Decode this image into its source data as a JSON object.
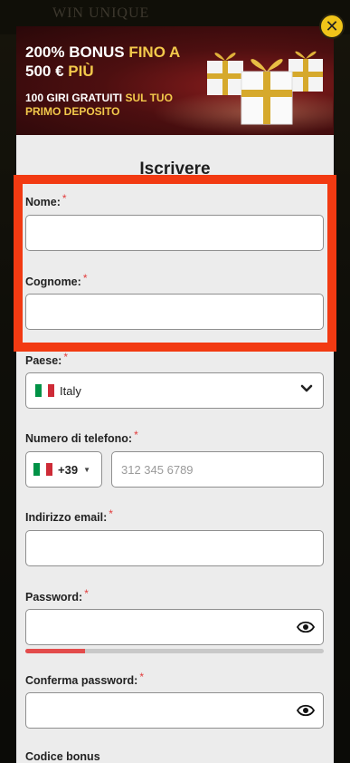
{
  "background": {
    "logo_text": "WIN UNIQUE"
  },
  "close_button": {
    "icon": "close-icon",
    "glyph": "✕"
  },
  "banner": {
    "title_white_1": "200% BONUS ",
    "title_gold_1": "FINO A",
    "title_white_2": "500 € ",
    "title_gold_2": "PIÙ",
    "sub_white": "100 GIRI GRATUITI ",
    "sub_gold": "SUL TUO PRIMO DEPOSITO"
  },
  "form": {
    "title": "Iscrivere",
    "required_mark": "*",
    "first_name": {
      "label": "Nome:",
      "value": ""
    },
    "last_name": {
      "label": "Cognome:",
      "value": ""
    },
    "country": {
      "label": "Paese:",
      "value": "Italy"
    },
    "phone": {
      "label": "Numero di telefono:",
      "code": "+39",
      "placeholder": "312 345 6789",
      "value": ""
    },
    "email": {
      "label": "Indirizzo email:",
      "value": ""
    },
    "password": {
      "label": "Password:",
      "value": "",
      "strength": 0.2
    },
    "confirm_password": {
      "label": "Conferma password:",
      "value": ""
    },
    "bonus_code": {
      "label": "Codice bonus"
    }
  },
  "colors": {
    "accent_gold": "#f3c94b",
    "close_button": "#f0c419",
    "highlight_box": "#f23a12",
    "strength_fill": "#e34b4b",
    "required": "#e23c3c",
    "flag_green": "#009246",
    "flag_white": "#ffffff",
    "flag_red": "#ce2b37"
  }
}
